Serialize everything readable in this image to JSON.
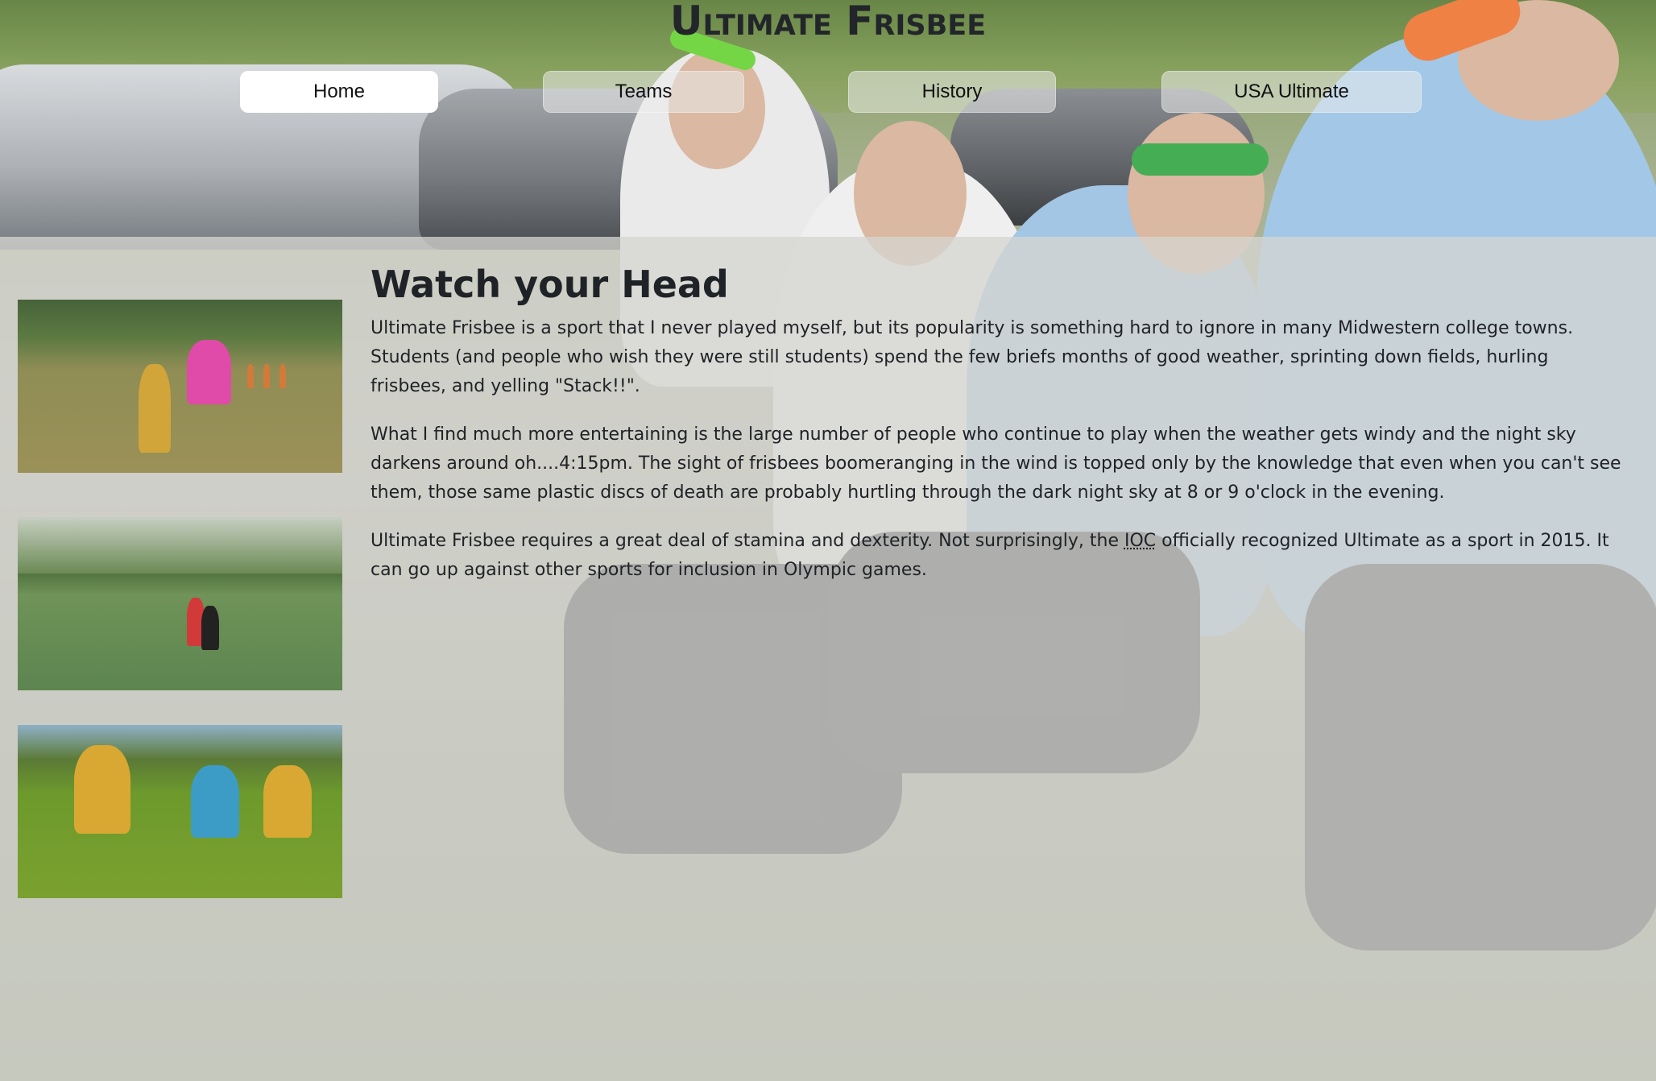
{
  "header": {
    "title": "Ultimate Frisbee"
  },
  "nav": {
    "items": [
      {
        "label": "Home",
        "active": true
      },
      {
        "label": "Teams",
        "active": false
      },
      {
        "label": "History",
        "active": false
      },
      {
        "label": "USA Ultimate",
        "active": false
      }
    ]
  },
  "main": {
    "heading": "Watch your Head",
    "paragraph1": "Ultimate Frisbee is a sport that I never played myself, but its popularity is something hard to ignore in many Midwestern college towns. Students (and people who wish they were still students) spend the few briefs months of good weather, sprinting down fields, hurling frisbees, and yelling \"Stack!!\".",
    "paragraph2": "What I find much more entertaining is the large number of people who continue to play when the weather gets windy and the night sky darkens around oh....4:15pm. The sight of frisbees boomeranging in the wind is topped only by the knowledge that even when you can't see them, those same plastic discs of death are probably hurtling through the dark night sky at 8 or 9 o'clock in the evening.",
    "paragraph3_before": "Ultimate Frisbee requires a great deal of stamina and dexterity. Not surprisingly, the ",
    "paragraph3_abbr": "IOC",
    "paragraph3_after": " officially recognized Ultimate as a sport in 2015. It can go up against other sports for inclusion in Olympic games."
  },
  "colors": {
    "overlay": "#d6d6d2",
    "text": "#1f2226",
    "nav_active": "#ffffff"
  }
}
